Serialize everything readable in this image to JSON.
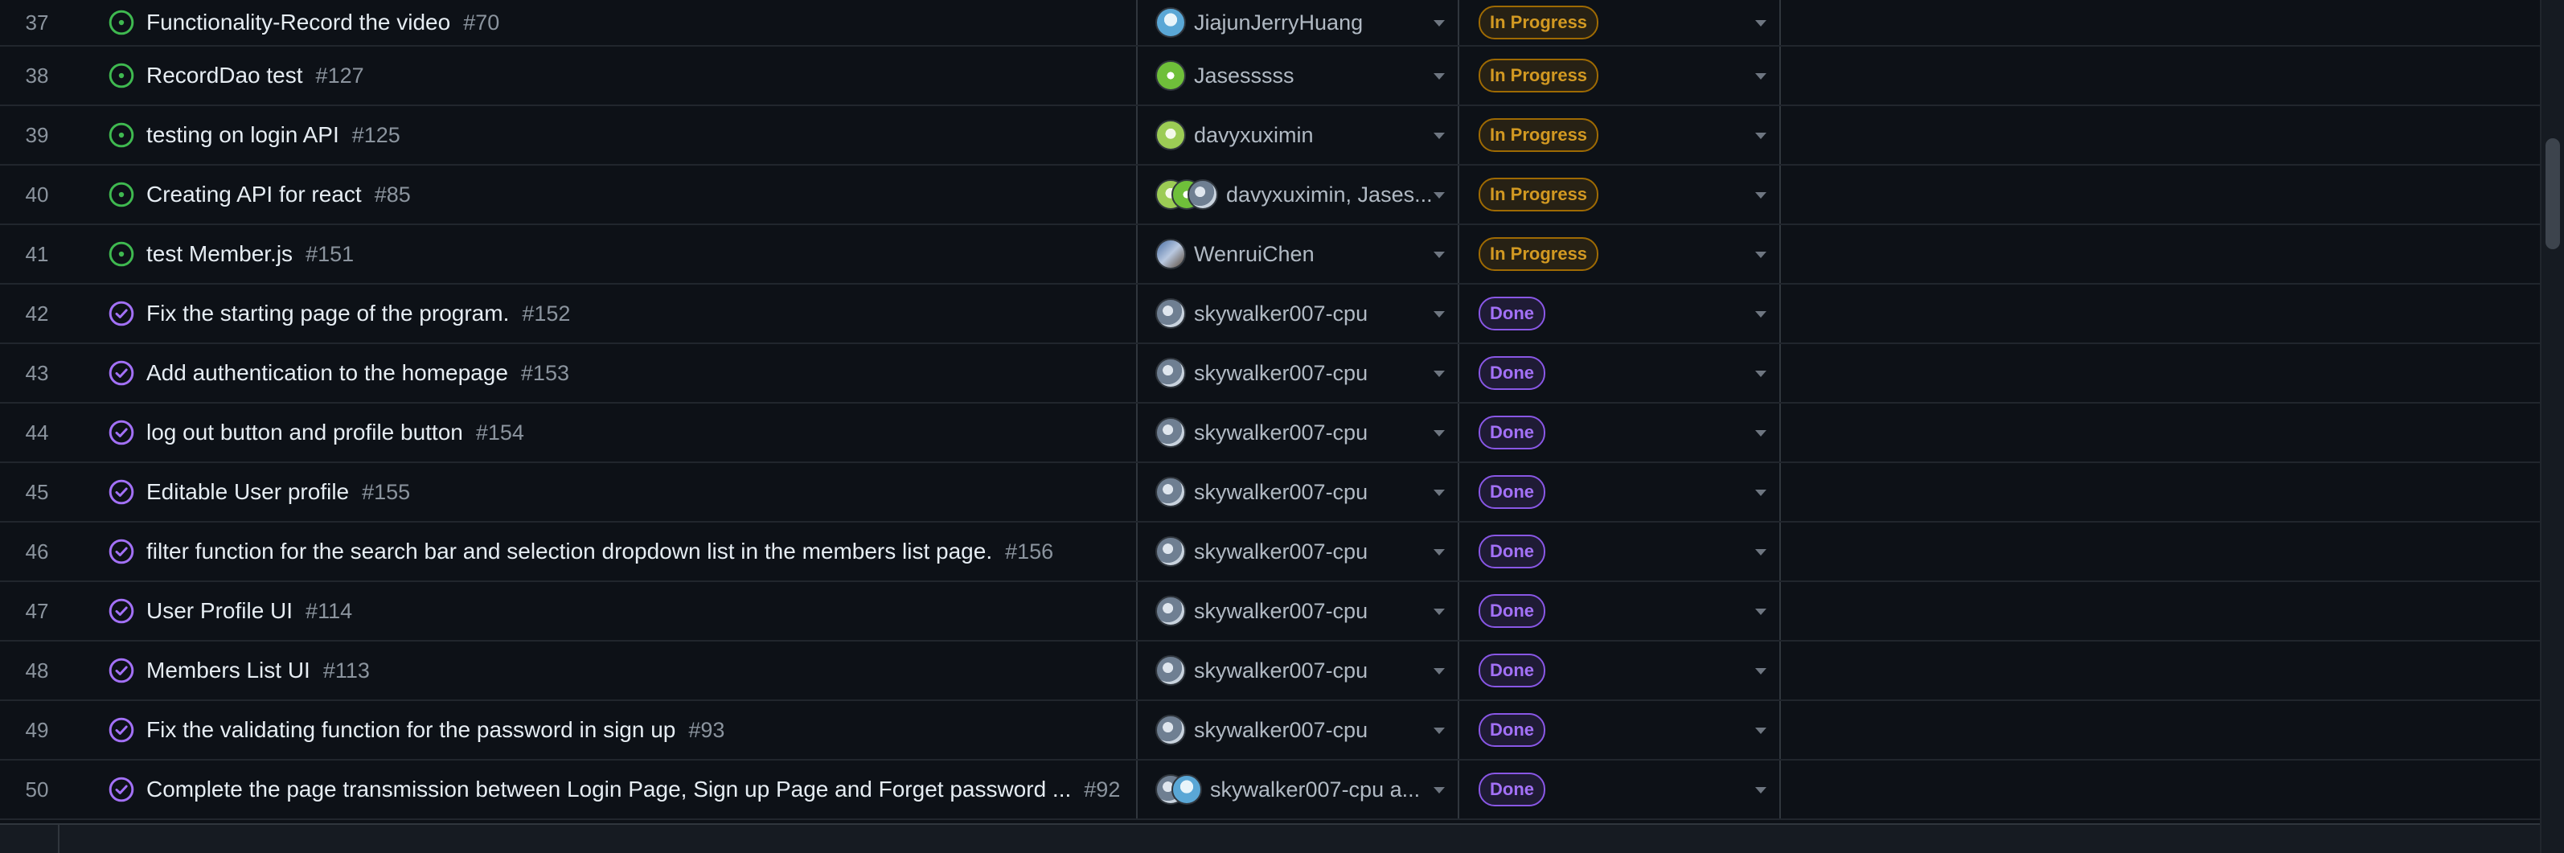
{
  "colors": {
    "open_icon": "#3fb950",
    "closed_icon": "#a371f7",
    "in_progress": "#d29922",
    "done": "#a371f7"
  },
  "rows": [
    {
      "num": "37",
      "title": "Functionality-Record the video",
      "issue": "#70",
      "state": "open",
      "assignee": "JiajunJerryHuang",
      "avatars": [
        "av-j"
      ],
      "status": "In Progress"
    },
    {
      "num": "38",
      "title": "RecordDao test",
      "issue": "#127",
      "state": "open",
      "assignee": "Jasesssss",
      "avatars": [
        "av-s"
      ],
      "status": "In Progress"
    },
    {
      "num": "39",
      "title": "testing on login API",
      "issue": "#125",
      "state": "open",
      "assignee": "davyxuximin",
      "avatars": [
        "av-d"
      ],
      "status": "In Progress"
    },
    {
      "num": "40",
      "title": "Creating API for react",
      "issue": "#85",
      "state": "open",
      "assignee": "davyxuximin, Jases...",
      "avatars": [
        "av-d",
        "av-s",
        "av-sky"
      ],
      "status": "In Progress"
    },
    {
      "num": "41",
      "title": "test Member.js",
      "issue": "#151",
      "state": "open",
      "assignee": "WenruiChen",
      "avatars": [
        "av-w"
      ],
      "status": "In Progress"
    },
    {
      "num": "42",
      "title": "Fix the starting page of the program.",
      "issue": "#152",
      "state": "closed",
      "assignee": "skywalker007-cpu",
      "avatars": [
        "av-sky"
      ],
      "status": "Done"
    },
    {
      "num": "43",
      "title": "Add authentication to the homepage",
      "issue": "#153",
      "state": "closed",
      "assignee": "skywalker007-cpu",
      "avatars": [
        "av-sky"
      ],
      "status": "Done"
    },
    {
      "num": "44",
      "title": "log out button and profile button",
      "issue": "#154",
      "state": "closed",
      "assignee": "skywalker007-cpu",
      "avatars": [
        "av-sky"
      ],
      "status": "Done"
    },
    {
      "num": "45",
      "title": "Editable User profile",
      "issue": "#155",
      "state": "closed",
      "assignee": "skywalker007-cpu",
      "avatars": [
        "av-sky"
      ],
      "status": "Done"
    },
    {
      "num": "46",
      "title": "filter function for the search bar and selection dropdown list in the members list page.",
      "issue": "#156",
      "state": "closed",
      "assignee": "skywalker007-cpu",
      "avatars": [
        "av-sky"
      ],
      "status": "Done"
    },
    {
      "num": "47",
      "title": "User Profile UI",
      "issue": "#114",
      "state": "closed",
      "assignee": "skywalker007-cpu",
      "avatars": [
        "av-sky"
      ],
      "status": "Done"
    },
    {
      "num": "48",
      "title": "Members List UI",
      "issue": "#113",
      "state": "closed",
      "assignee": "skywalker007-cpu",
      "avatars": [
        "av-sky"
      ],
      "status": "Done"
    },
    {
      "num": "49",
      "title": "Fix the validating function for the password in sign up",
      "issue": "#93",
      "state": "closed",
      "assignee": "skywalker007-cpu",
      "avatars": [
        "av-sky"
      ],
      "status": "Done"
    },
    {
      "num": "50",
      "title": "Complete the page transmission between Login Page, Sign up Page and Forget password ...",
      "issue": "#92",
      "state": "closed",
      "assignee": "skywalker007-cpu a...",
      "avatars": [
        "av-sky",
        "av-j"
      ],
      "status": "Done"
    }
  ]
}
